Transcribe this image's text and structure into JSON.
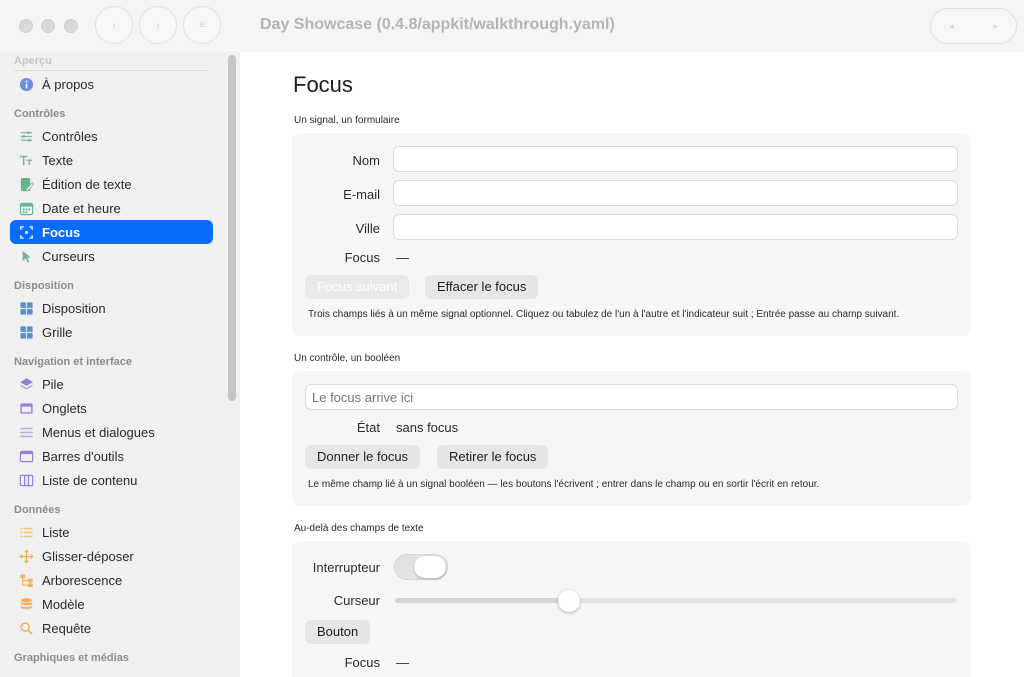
{
  "window": {
    "title": "Day Showcase (0.4.8/appkit/walkthrough.yaml)",
    "nav_buttons": [
      "back-icon",
      "forward-icon",
      "sidebar-toggle-icon"
    ]
  },
  "sidebar": {
    "sections": [
      {
        "title": "Aperçu",
        "items": [
          {
            "label": "À propos",
            "icon": "info-icon",
            "color": "#6a8fe0"
          }
        ]
      },
      {
        "title": "Contrôles",
        "items": [
          {
            "label": "Contrôles",
            "icon": "sliders-icon",
            "color": "#7fb3a8"
          },
          {
            "label": "Texte",
            "icon": "text-icon",
            "color": "#7fb3a8"
          },
          {
            "label": "Édition de texte",
            "icon": "edit-document-icon",
            "color": "#6ab38a"
          },
          {
            "label": "Date et heure",
            "icon": "calendar-icon",
            "color": "#6ab3a0"
          },
          {
            "label": "Focus",
            "icon": "focus-icon",
            "color": "#ffffff",
            "active": true
          },
          {
            "label": "Curseurs",
            "icon": "cursor-icon",
            "color": "#6ab3a0"
          }
        ]
      },
      {
        "title": "Disposition",
        "items": [
          {
            "label": "Disposition",
            "icon": "layout-grid-icon",
            "color": "#5a8fd6"
          },
          {
            "label": "Grille",
            "icon": "grid-icon",
            "color": "#5a8fd6"
          }
        ]
      },
      {
        "title": "Navigation et interface",
        "items": [
          {
            "label": "Pile",
            "icon": "stack-icon",
            "color": "#9a7fd6"
          },
          {
            "label": "Onglets",
            "icon": "tabs-icon",
            "color": "#9a7fd6"
          },
          {
            "label": "Menus et dialogues",
            "icon": "menu-icon",
            "color": "#b8a8e0"
          },
          {
            "label": "Barres d'outils",
            "icon": "toolbar-icon",
            "color": "#9a7fd6"
          },
          {
            "label": "Liste de contenu",
            "icon": "columns-icon",
            "color": "#9a7fd6"
          }
        ]
      },
      {
        "title": "Données",
        "items": [
          {
            "label": "Liste",
            "icon": "list-icon",
            "color": "#f0c070"
          },
          {
            "label": "Glisser-déposer",
            "icon": "drag-icon",
            "color": "#f0b060"
          },
          {
            "label": "Arborescence",
            "icon": "tree-icon",
            "color": "#f0b060"
          },
          {
            "label": "Modèle",
            "icon": "database-icon",
            "color": "#f0b060"
          },
          {
            "label": "Requête",
            "icon": "search-icon",
            "color": "#f0b060"
          }
        ]
      },
      {
        "title": "Graphiques et médias",
        "items": []
      }
    ]
  },
  "main": {
    "title": "Focus",
    "section1": {
      "heading": "Un signal, un formulaire",
      "fields": [
        {
          "label": "Nom",
          "value": ""
        },
        {
          "label": "E-mail",
          "value": ""
        },
        {
          "label": "Ville",
          "value": ""
        }
      ],
      "focus_label": "Focus",
      "focus_value": "—",
      "btn_next": "Focus suivant",
      "btn_clear": "Effacer le focus",
      "note": "Trois champs liés à un même signal optionnel. Cliquez ou tabulez de l'un à l'autre et l'indicateur suit ; Entrée passe au champ suivant."
    },
    "section2": {
      "heading": "Un contrôle, un booléen",
      "placeholder": "Le focus arrive ici",
      "state_label": "État",
      "state_value": "sans focus",
      "btn_give": "Donner le focus",
      "btn_remove": "Retirer le focus",
      "note": "Le même champ lié à un signal booléen — les boutons l'écrivent ; entrer dans le champ ou en sortir l'écrit en retour."
    },
    "section3": {
      "heading": "Au-delà des champs de texte",
      "switch_label": "Interrupteur",
      "switch_on": false,
      "slider_label": "Curseur",
      "slider_value": 0.31,
      "button_label": "Bouton",
      "focus_label": "Focus",
      "focus_value": "—"
    }
  }
}
